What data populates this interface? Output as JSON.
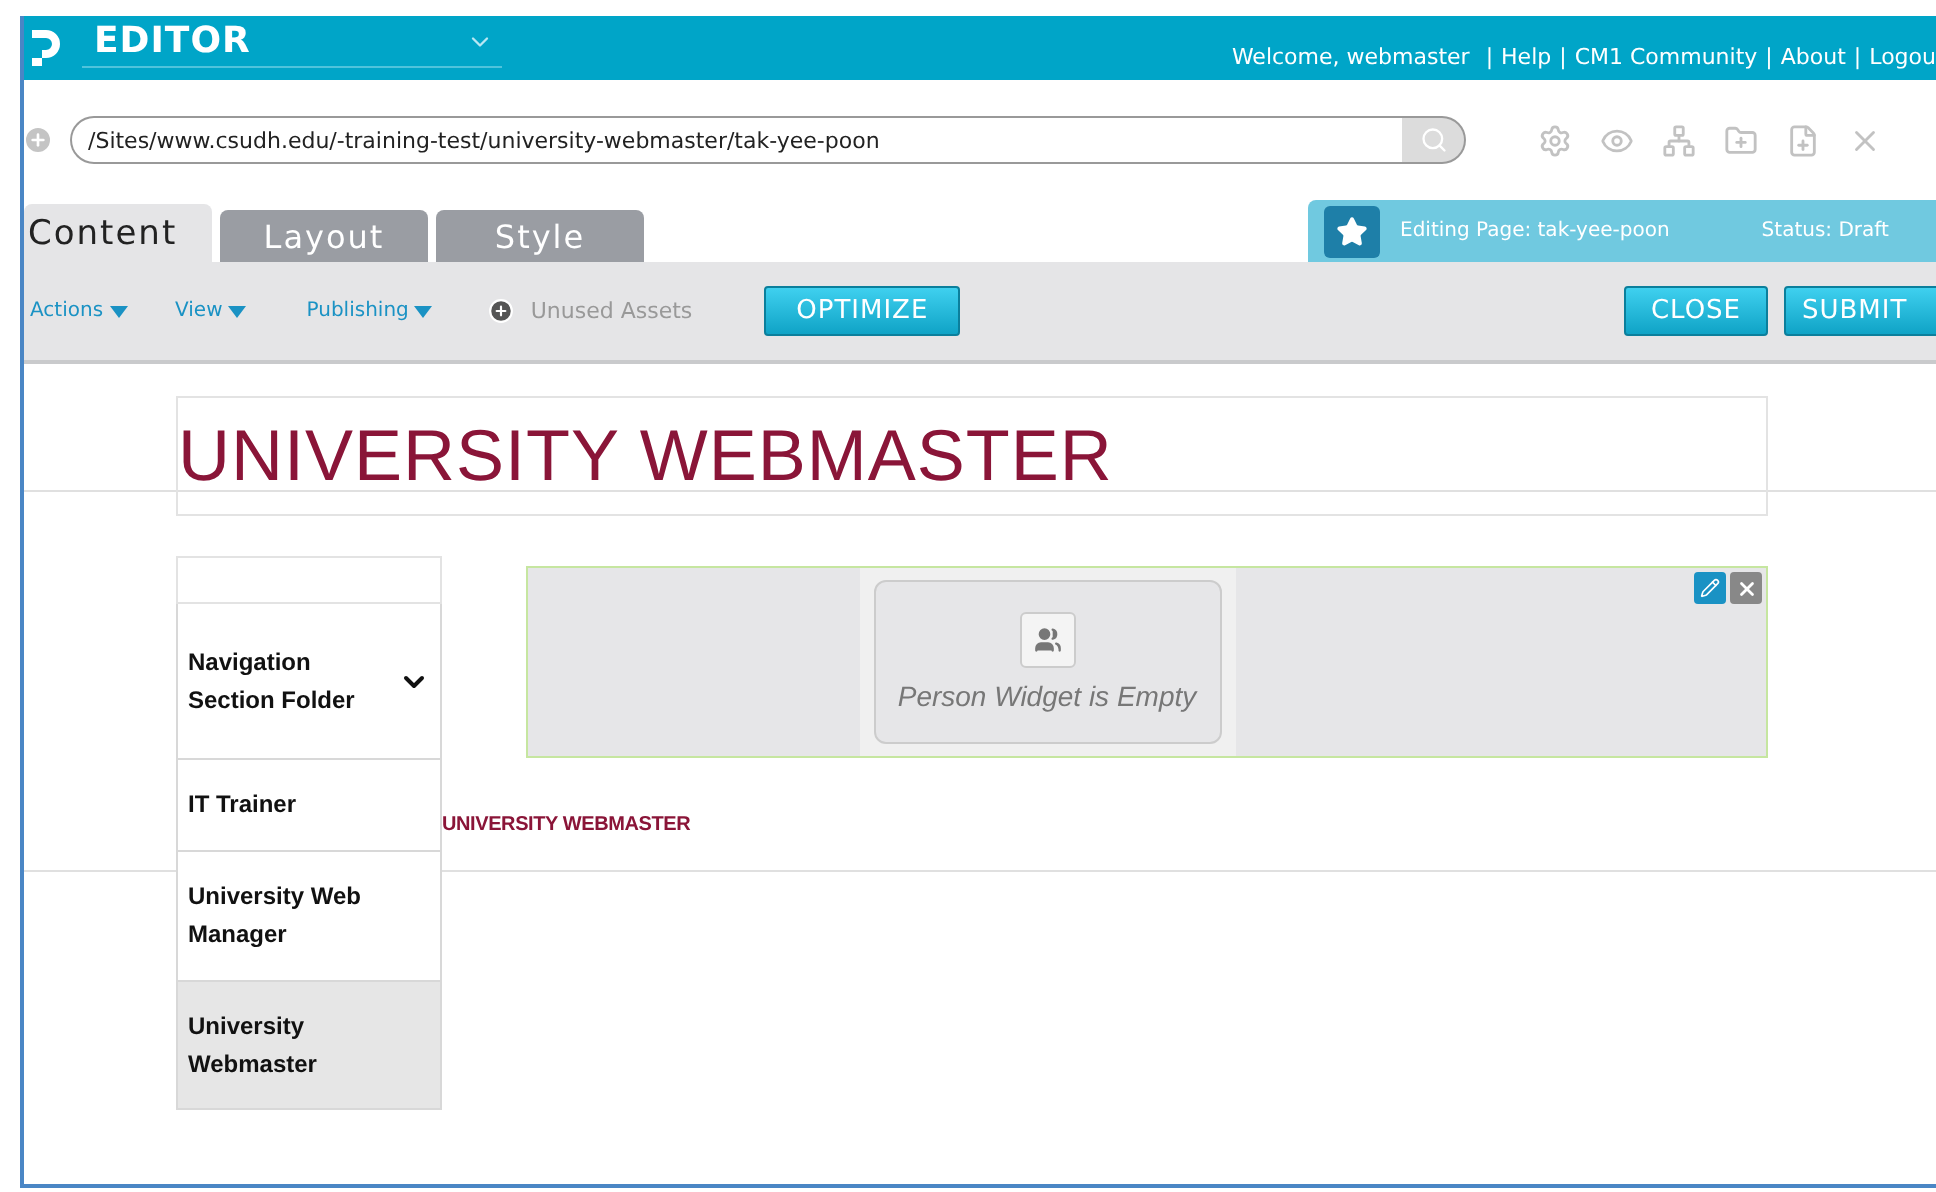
{
  "app": {
    "title": "EDITOR"
  },
  "user_bar": {
    "welcome": "Welcome, webmaster",
    "separators": [
      "|",
      "|",
      "|",
      "|"
    ],
    "links": [
      "Help",
      "CM1 Community",
      "About",
      "Logou"
    ]
  },
  "path": {
    "value": "/Sites/www.csudh.edu/-training-test/university-webmaster/tak-yee-poon"
  },
  "tabs": [
    {
      "label": "Content",
      "selected": true
    },
    {
      "label": "Layout",
      "selected": false
    },
    {
      "label": "Style",
      "selected": false
    }
  ],
  "page_info": {
    "editing": "Editing Page: tak-yee-poon",
    "status": "Status: Draft"
  },
  "menus": [
    "Actions",
    "View",
    "Publishing"
  ],
  "unused_assets": "Unused Assets",
  "buttons": {
    "optimize": "OPTIMIZE",
    "close": "CLOSE",
    "submit": "SUBMIT"
  },
  "page": {
    "heading": "UNIVERSITY WEBMASTER",
    "nav": [
      {
        "label": "Navigation Section Folder",
        "kind": "folder",
        "selected": false
      },
      {
        "label": "IT Trainer",
        "kind": "page",
        "selected": false
      },
      {
        "label": "University Web Manager",
        "kind": "page",
        "selected": false
      },
      {
        "label": "University Webmaster",
        "kind": "page",
        "selected": true
      }
    ],
    "widget": {
      "empty_text": "Person Widget is Empty"
    },
    "breadcrumb": "UNIVERSITY WEBMASTER"
  }
}
